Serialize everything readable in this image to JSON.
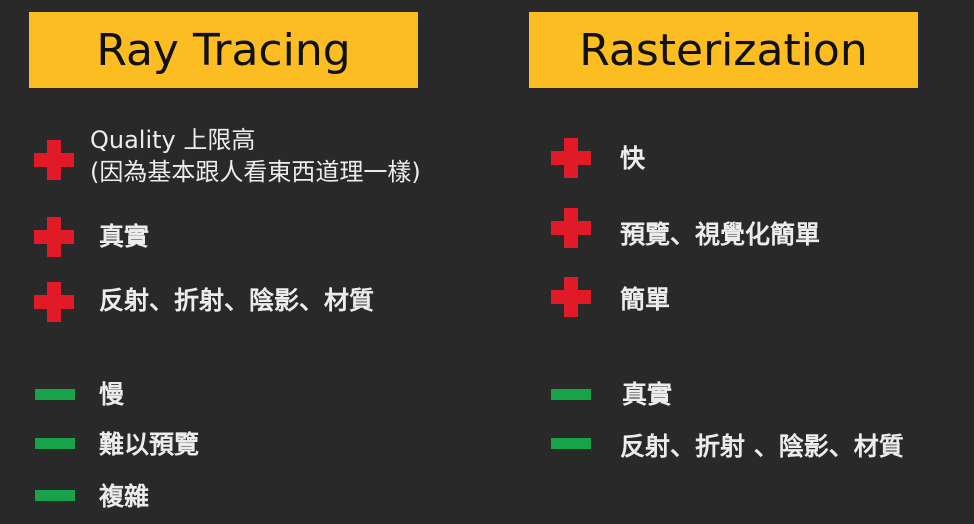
{
  "left": {
    "title": "Ray Tracing",
    "pros": [
      {
        "line1": "Quality 上限高",
        "line2": "(因為基本跟人看東西道理一樣)"
      },
      {
        "text": "真實"
      },
      {
        "text": "反射、折射、陰影、材質"
      }
    ],
    "cons": [
      "慢",
      "難以預覽",
      "複雜"
    ]
  },
  "right": {
    "title": "Rasterization",
    "pros": [
      "快",
      "預覽、視覺化簡單",
      "簡單"
    ],
    "cons": [
      "真實",
      "反射、折射 、陰影、材質"
    ]
  },
  "colors": {
    "header_bg": "#fbbd22",
    "plus": "#e01a26",
    "minus": "#17a34a",
    "background": "#292929"
  },
  "icons": {
    "pro": "plus-icon",
    "con": "minus-icon"
  }
}
